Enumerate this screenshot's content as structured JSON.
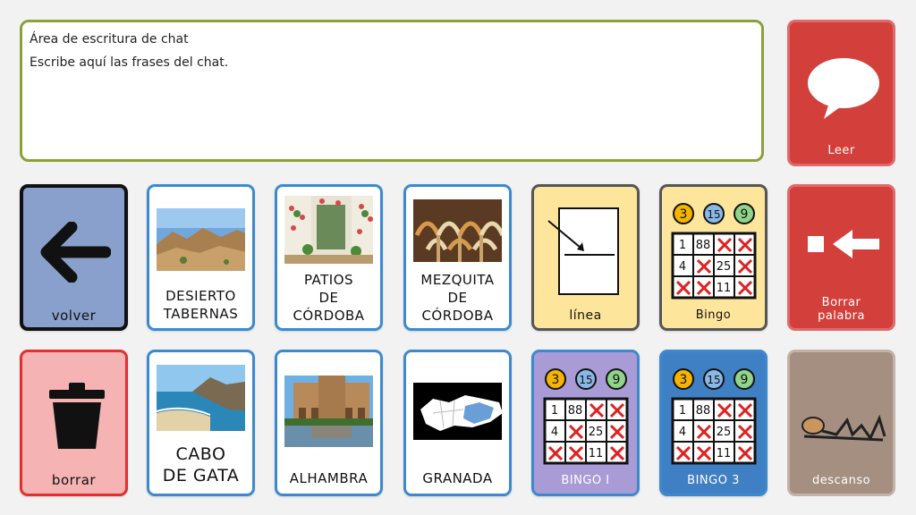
{
  "chat": {
    "title": "Área de escritura de chat",
    "hint": "Escribe aquí las frases del chat."
  },
  "tiles": {
    "volver": "volver",
    "desierto_l1": "DESIERTO",
    "desierto_l2": "TABERNAS",
    "patios_l1": "PATIOS",
    "patios_l2": "DE",
    "patios_l3": "CÓRDOBA",
    "mezquita_l1": "MEZQUITA",
    "mezquita_l2": "DE",
    "mezquita_l3": "CÓRDOBA",
    "linea": "línea",
    "bingo": "Bingo",
    "borrar": "borrar",
    "cabo_l1": "CABO",
    "cabo_l2": "DE GATA",
    "alhambra": "ALHAMBRA",
    "granada": "GRANADA",
    "bingo1": "BINGO I",
    "bingo3": "BINGO 3"
  },
  "side": {
    "leer": "Leer",
    "borrar_palabra_l1": "Borrar",
    "borrar_palabra_l2": "palabra",
    "descanso": "descanso"
  },
  "bingo_card": {
    "balls": [
      "3",
      "15",
      "9"
    ],
    "row1": [
      "1",
      "88"
    ],
    "row2": [
      "4",
      "25"
    ],
    "row3": [
      "11"
    ]
  }
}
